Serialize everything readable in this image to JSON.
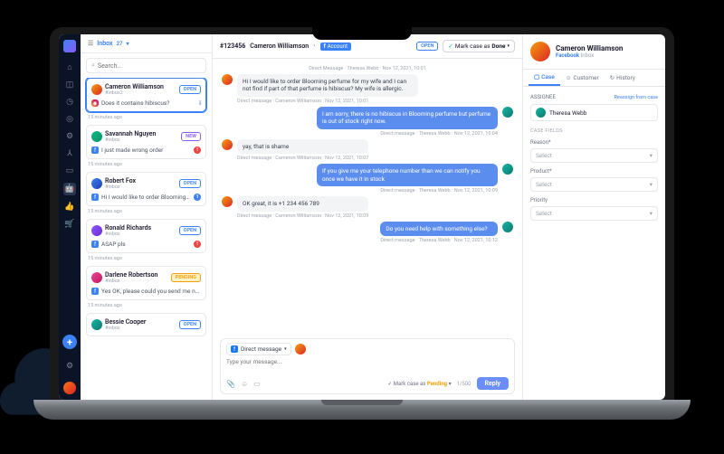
{
  "header": {
    "inbox_label": "Inbox",
    "inbox_count": "27"
  },
  "search": {
    "placeholder": "Search..."
  },
  "cards": [
    {
      "name": "Cameron Williamson",
      "handle": "#inbox2",
      "badge": "OPEN",
      "badge_cls": "b-open",
      "active": true,
      "chan": "ig",
      "msg": "Does it contains hibiscus?",
      "time": "15 minutes ago",
      "status": "i"
    },
    {
      "name": "Savannah Nguyen",
      "handle": "#inbox",
      "badge": "NEW",
      "badge_cls": "b-new",
      "chan": "fb",
      "msg": "I just made wrong order",
      "time": "15 minutes ago",
      "status": "red"
    },
    {
      "name": "Robert Fox",
      "handle": "#inbox",
      "badge": "OPEN",
      "badge_cls": "b-open",
      "chan": "fb",
      "msg": "Hi I would like to order Blooming perfume...",
      "time": "15 minutes ago",
      "status": "blue"
    },
    {
      "name": "Ronald Richards",
      "handle": "#inbox",
      "badge": "OPEN",
      "badge_cls": "b-open",
      "chan": "fb",
      "msg": "ASAP pls",
      "time": "15 minutes ago",
      "status": "red"
    },
    {
      "name": "Darlene Robertson",
      "handle": "#inbox",
      "badge": "PENDING",
      "badge_cls": "b-pending",
      "chan": "fb",
      "msg": "Yes OK, please could you send me number of...",
      "time": "15 minutes ago",
      "status": ""
    },
    {
      "name": "Bessie Cooper",
      "handle": "#inbox",
      "badge": "OPEN",
      "badge_cls": "b-open",
      "chan": "fb",
      "msg": "",
      "time": "",
      "status": ""
    }
  ],
  "conv": {
    "ticket": "#123456",
    "customer": "Cameron Williamson",
    "channel": "Account",
    "open_label": "OPEN",
    "done_prefix": "Mark case as",
    "done_label": "Done"
  },
  "msgs": {
    "top_meta": "Direct Message · Theresa Webb · Nov 12, 2021, 10:01",
    "m1": "Hi I would like to order Blooming perfume for my wife and I can not find if part of that perfume is hibiscus? My wife is allergic.",
    "m1_meta": "Direct message · Cameron Williamson · Nov 12, 2021, 10:01",
    "m2": "I am sorry, there is no hibiscus in Blooming perfume but perfume is out of stock right now.",
    "m2_meta": "Direct message · Theresa Webb · Nov 12, 2021, 10:04",
    "m3": "yay, that is shame",
    "m3_meta": "Direct message · Cameron Williamson · Nov 12, 2021, 10:07",
    "m4": "If you give me your telephone number than we can notify you once we have it in stock",
    "m4_meta": "Direct message · Theresa Webb · Nov 12, 2021, 10:09",
    "m5": "OK great, it is +1 234 456 789",
    "m5_meta": "Direct message · Cameron Williamson · Nov 12, 2021, 10:09",
    "m6": "Do you need help with something else?",
    "m6_meta": "Direct message · Theresa Webb · Nov 12, 2021, 10:12"
  },
  "composer": {
    "channel": "Direct message",
    "placeholder": "Type your message...",
    "mark_prefix": "Mark case as",
    "mark_status": "Pending",
    "counter": "1/500",
    "reply": "Reply"
  },
  "side": {
    "name": "Cameron Williamson",
    "channel": "Facebook",
    "sub2": "Inbox",
    "tab_case": "Case",
    "tab_customer": "Customer",
    "tab_history": "History",
    "assignee_label": "ASSIGNEE",
    "reassign": "Reassign from case",
    "assignee": "Theresa Webb",
    "case_fields": "CASE FIELDS",
    "f_reason": "Reason*",
    "f_product": "Product*",
    "f_priority": "Priority",
    "select": "Select"
  }
}
